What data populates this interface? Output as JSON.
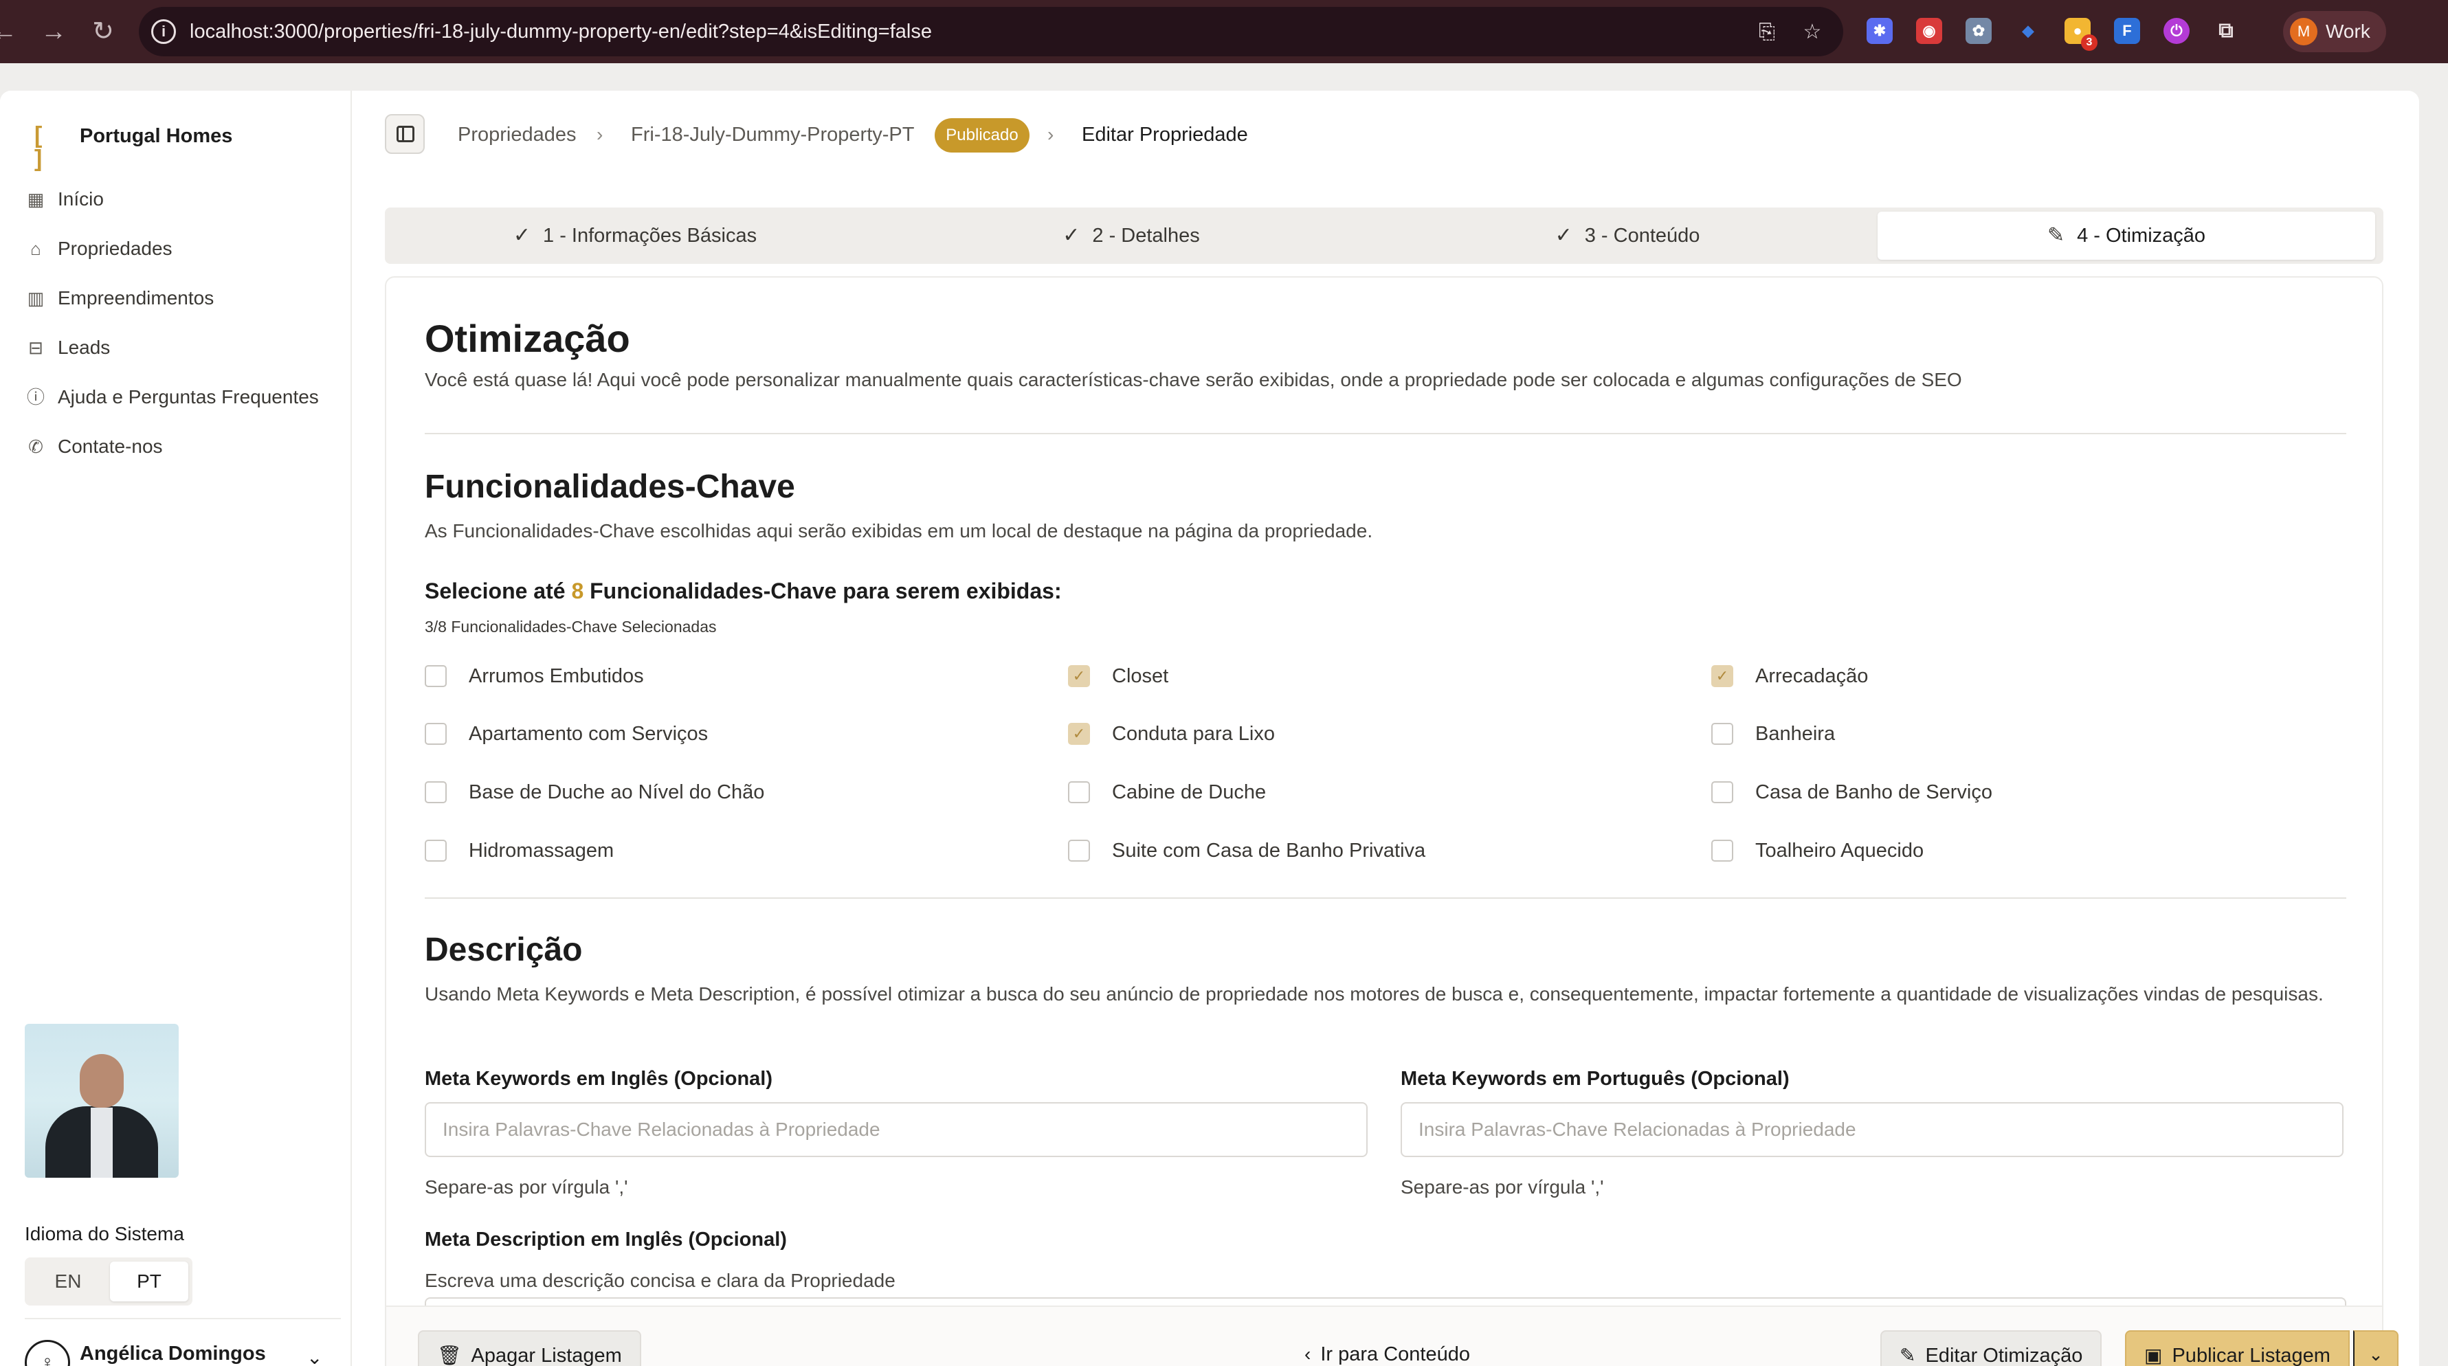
{
  "browser": {
    "url": "localhost:3000/properties/fri-18-july-dummy-property-en/edit?step=4&isEditing=false",
    "back_icon": "arrow-left-icon",
    "forward_icon": "arrow-right-icon",
    "reload_icon": "reload-icon",
    "extension_badge": "3",
    "profile_initial": "M",
    "profile_name": "Work"
  },
  "sidebar": {
    "brand": "Portugal Homes",
    "items": [
      {
        "label": "Início",
        "icon": "grid-icon"
      },
      {
        "label": "Propriedades",
        "icon": "home-icon"
      },
      {
        "label": "Empreendimentos",
        "icon": "building-icon"
      },
      {
        "label": "Leads",
        "icon": "inbox-icon"
      },
      {
        "label": "Ajuda e Perguntas Frequentes",
        "icon": "help-icon"
      },
      {
        "label": "Contate-nos",
        "icon": "phone-icon"
      }
    ],
    "language_title": "Idioma do Sistema",
    "language_options": [
      "EN",
      "PT"
    ],
    "language_selected": "PT",
    "user_name": "Angélica Domingos"
  },
  "breadcrumb": {
    "items": [
      "Propriedades",
      "Fri-18-July-Dummy-Property-PT",
      "Editar Propriedade"
    ],
    "status_badge": "Publicado"
  },
  "steps": [
    {
      "label": "1 - Informações Básicas",
      "state": "done"
    },
    {
      "label": "2 - Detalhes",
      "state": "done"
    },
    {
      "label": "3 - Conteúdo",
      "state": "done"
    },
    {
      "label": "4 - Otimização",
      "state": "active"
    }
  ],
  "optimization": {
    "title": "Otimização",
    "subtitle": "Você está quase lá! Aqui você pode personalizar manualmente quais características-chave serão exibidas, onde a propriedade pode ser colocada e algumas configurações de SEO"
  },
  "key_features": {
    "title": "Funcionalidades-Chave",
    "description": "As Funcionalidades-Chave escolhidas aqui serão exibidas em um local de destaque na página da propriedade.",
    "select_prefix": "Selecione até ",
    "select_max": "8",
    "select_suffix": " Funcionalidades-Chave para serem exibidas:",
    "selected_count_text": "3/8 Funcionalidades-Chave Selecionadas",
    "items": [
      {
        "label": "Arrumos Embutidos",
        "checked": false
      },
      {
        "label": "Closet",
        "checked": true
      },
      {
        "label": "Arrecadação",
        "checked": true
      },
      {
        "label": "Apartamento com Serviços",
        "checked": false
      },
      {
        "label": "Conduta para Lixo",
        "checked": true
      },
      {
        "label": "Banheira",
        "checked": false
      },
      {
        "label": "Base de Duche ao Nível do Chão",
        "checked": false
      },
      {
        "label": "Cabine de Duche",
        "checked": false
      },
      {
        "label": "Casa de Banho de Serviço",
        "checked": false
      },
      {
        "label": "Hidromassagem",
        "checked": false
      },
      {
        "label": "Suite com Casa de Banho Privativa",
        "checked": false
      },
      {
        "label": "Toalheiro Aquecido",
        "checked": false
      }
    ]
  },
  "description": {
    "title": "Descrição",
    "text": "Usando Meta Keywords e Meta Description, é possível otimizar a busca do seu anúncio de propriedade nos motores de busca e, consequentemente, impactar fortemente a quantidade de visualizações vindas de pesquisas.",
    "keywords_en_label": "Meta Keywords em Inglês (Opcional)",
    "keywords_pt_label": "Meta Keywords em Português (Opcional)",
    "keywords_placeholder": "Insira Palavras-Chave Relacionadas à Propriedade",
    "keywords_en_value": "",
    "keywords_pt_value": "",
    "keywords_help": "Separe-as por vírgula ','",
    "meta_desc_en_label": "Meta Description em Inglês (Opcional)",
    "meta_desc_help": "Escreva uma descrição concisa e clara da Propriedade"
  },
  "actions": {
    "delete": "Apagar Listagem",
    "go_to_content": "Ir para Conteúdo",
    "edit_optimization": "Editar Otimização",
    "publish": "Publicar Listagem"
  },
  "colors": {
    "accent": "#c8992a",
    "checked_box": "#e5d3ae",
    "browser_frame": "#3d1f25"
  }
}
